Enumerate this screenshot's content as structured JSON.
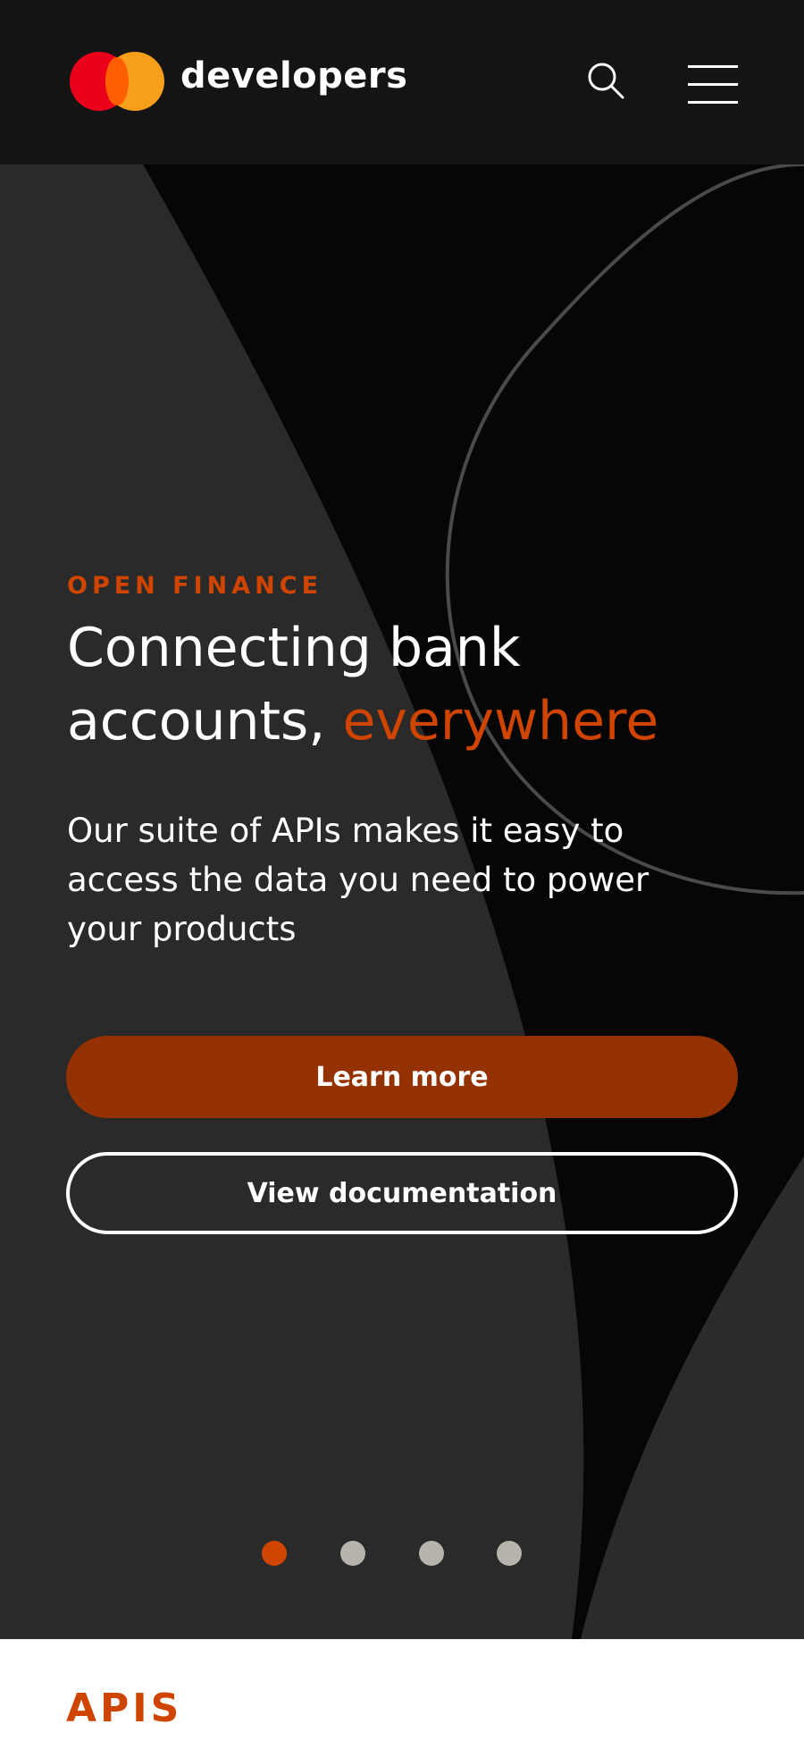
{
  "header": {
    "brand": "developers"
  },
  "hero": {
    "eyebrow": "OPEN FINANCE",
    "headline_main": "Connecting bank accounts,",
    "headline_accent": "everywhere",
    "description": "Our suite of APIs makes it easy to access the data you need to power your products",
    "primary_button": "Learn more",
    "secondary_button": "View documentation",
    "carousel": {
      "total": 4,
      "active": 1
    }
  },
  "section": {
    "title": "APIS"
  },
  "colors": {
    "accent": "#cf4500",
    "primary_button": "#943100",
    "header_bg": "#141414",
    "dot_inactive": "#b6b4ac"
  },
  "icons": [
    "mastercard-logo",
    "search-icon",
    "hamburger-menu-icon"
  ]
}
